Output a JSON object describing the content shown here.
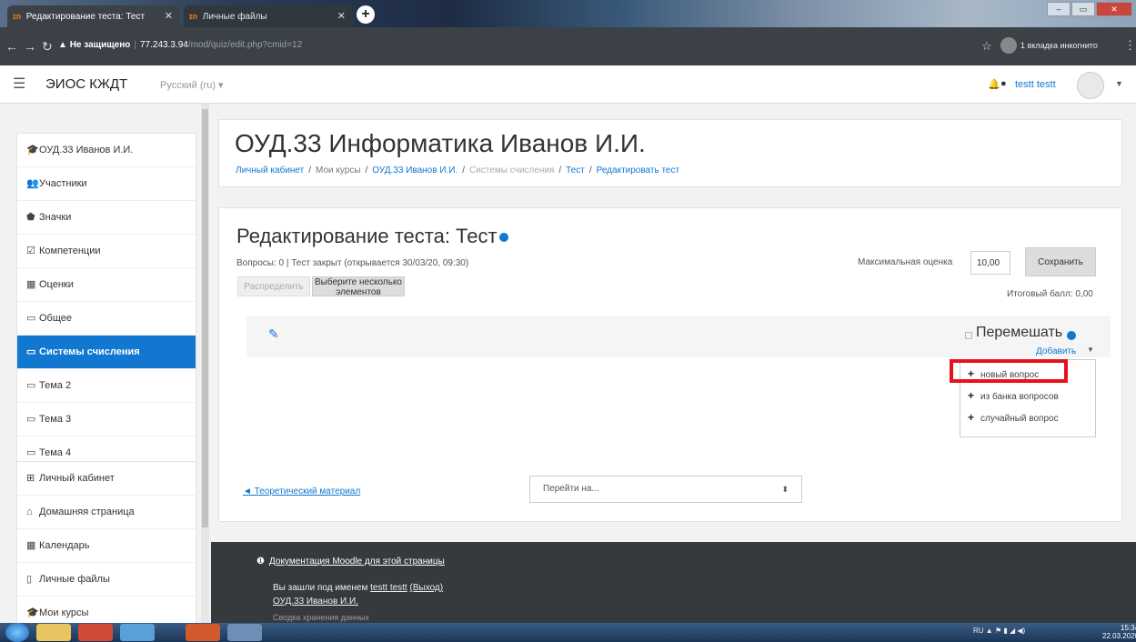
{
  "browser": {
    "tabs": [
      {
        "label": "Редактирование теста: Тест",
        "active": true
      },
      {
        "label": "Личные файлы",
        "active": false
      }
    ],
    "new_tab": "+",
    "security": "Не защищено",
    "url_host": "77.243.3.94",
    "url_path": "/mod/quiz/edit.php?cmid=12",
    "incognito": "1 вкладка инкогнито"
  },
  "navbar": {
    "brand": "ЭИОС КЖДТ",
    "language": "Русский (ru) ▾",
    "user": "testt testt"
  },
  "drawer": {
    "group1": [
      {
        "icon": "🎓",
        "label": "ОУД.33 Иванов И.И."
      },
      {
        "icon": "👥",
        "label": "Участники"
      },
      {
        "icon": "⬟",
        "label": "Значки"
      },
      {
        "icon": "☑",
        "label": "Компетенции"
      },
      {
        "icon": "▦",
        "label": "Оценки"
      },
      {
        "icon": "▭",
        "label": "Общее"
      },
      {
        "icon": "▭",
        "label": "Системы счисления",
        "active": true
      },
      {
        "icon": "▭",
        "label": "Тема 2"
      },
      {
        "icon": "▭",
        "label": "Тема 3"
      },
      {
        "icon": "▭",
        "label": "Тема 4"
      }
    ],
    "group2": [
      {
        "icon": "⊞",
        "label": "Личный кабинет"
      },
      {
        "icon": "⌂",
        "label": "Домашняя страница"
      },
      {
        "icon": "▦",
        "label": "Календарь"
      },
      {
        "icon": "▯",
        "label": "Личные файлы"
      },
      {
        "icon": "🎓",
        "label": "Мои курсы"
      }
    ]
  },
  "header": {
    "title": "ОУД.33 Информатика Иванов И.И.",
    "breadcrumb": [
      {
        "label": "Личный кабинет",
        "link": true
      },
      {
        "label": "Мои курсы",
        "link": false
      },
      {
        "label": "ОУД.33 Иванов И.И.",
        "link": true
      },
      {
        "label": "Системы счисления",
        "link": false
      },
      {
        "label": "Тест",
        "link": true
      },
      {
        "label": "Редактировать тест",
        "link": true
      }
    ]
  },
  "quiz": {
    "title": "Редактирование теста: Тест",
    "info": "Вопросы: 0 | Тест закрыт (открывается 30/03/20, 09:30)",
    "max_grade_label": "Максимальная оценка",
    "max_grade_value": "10,00",
    "save_label": "Сохранить",
    "repaginate_label": "Распределить",
    "select_multiple_label": "Выберите несколько элементов",
    "total_grade": "Итоговый балл: 0,00",
    "shuffle_label": "Перемешать",
    "add_label": "Добавить",
    "add_menu": [
      "новый вопрос",
      "из банка вопросов",
      "случайный вопрос"
    ],
    "prev_link": "◄ Теоретический материал",
    "jump_placeholder": "Перейти на..."
  },
  "footer": {
    "doc_link": "Документация Moodle для этой страницы",
    "logged_in_prefix": "Вы зашли под именем",
    "logged_in_user": "testt testt",
    "logout": "(Выход)",
    "course_link": "ОУД.33 Иванов И.И.",
    "truncated": "Сводка хранения данных"
  },
  "taskbar": {
    "lang": "RU",
    "time": "15:34",
    "date": "22.03.2020"
  },
  "colors": {
    "accent": "#1177d1",
    "highlight": "#e8101a",
    "footer_bg": "#373a3c"
  }
}
